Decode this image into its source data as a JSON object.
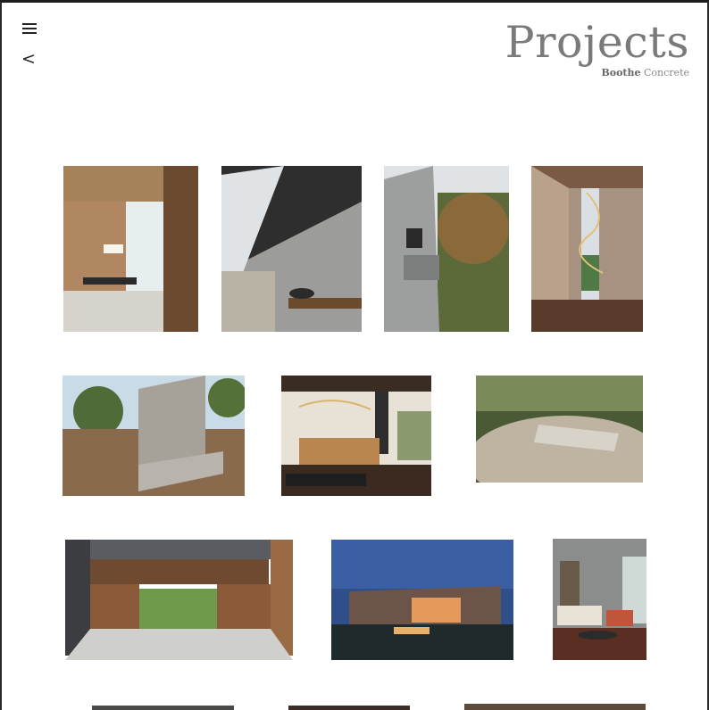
{
  "header": {
    "title": "Projects",
    "subtitle_bold": "Boothe",
    "subtitle_rest": " Concrete"
  },
  "nav": {
    "menu_icon": "hamburger-menu-icon",
    "back_icon": "chevron-left-icon",
    "back_glyph": "<"
  },
  "gallery": {
    "items": [
      "project-dining-room-wood-slats",
      "project-board-formed-concrete-skylight",
      "project-concrete-tower-window",
      "project-hallway-spiral-light",
      "project-concrete-wall-sample",
      "project-kitchen-pendant-lights",
      "project-concrete-bench-patio",
      "project-covered-breezeway",
      "project-house-exterior-dusk",
      "project-living-room-concrete",
      "project-partial-row4-1",
      "project-partial-row4-2",
      "project-partial-row4-3"
    ]
  }
}
